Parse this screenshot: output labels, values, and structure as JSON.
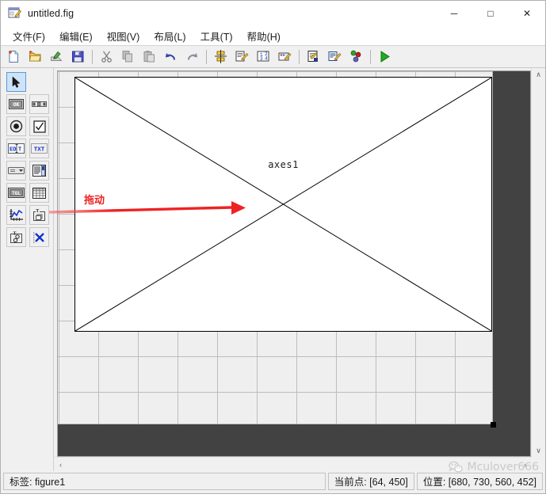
{
  "window": {
    "title": "untitled.fig",
    "icon": "guide-figure-icon",
    "minimize": "─",
    "maximize": "□",
    "close": "✕"
  },
  "menu": {
    "items": [
      {
        "label": "文件(F)",
        "name": "menu-file"
      },
      {
        "label": "编辑(E)",
        "name": "menu-edit"
      },
      {
        "label": "视图(V)",
        "name": "menu-view"
      },
      {
        "label": "布局(L)",
        "name": "menu-layout"
      },
      {
        "label": "工具(T)",
        "name": "menu-tools"
      },
      {
        "label": "帮助(H)",
        "name": "menu-help"
      }
    ]
  },
  "toolbar": {
    "buttons": [
      {
        "name": "new-figure-icon",
        "tip": "New"
      },
      {
        "name": "open-figure-icon",
        "tip": "Open"
      },
      {
        "name": "export-figure-icon",
        "tip": "Export"
      },
      {
        "name": "save-figure-icon",
        "tip": "Save"
      },
      {
        "name": "separator"
      },
      {
        "name": "cut-icon",
        "tip": "Cut"
      },
      {
        "name": "copy-icon",
        "tip": "Copy"
      },
      {
        "name": "paste-icon",
        "tip": "Paste"
      },
      {
        "name": "undo-icon",
        "tip": "Undo"
      },
      {
        "name": "redo-icon",
        "tip": "Redo"
      },
      {
        "name": "separator"
      },
      {
        "name": "align-objects-icon",
        "tip": "Align Objects"
      },
      {
        "name": "menu-editor-icon",
        "tip": "Menu Editor"
      },
      {
        "name": "tab-order-editor-icon",
        "tip": "Tab Order Editor"
      },
      {
        "name": "toolbar-editor-icon",
        "tip": "Toolbar Editor"
      },
      {
        "name": "separator"
      },
      {
        "name": "m-file-editor-icon",
        "tip": "M-file Editor"
      },
      {
        "name": "property-inspector-icon",
        "tip": "Property Inspector"
      },
      {
        "name": "object-browser-icon",
        "tip": "Object Browser"
      },
      {
        "name": "separator"
      },
      {
        "name": "run-figure-icon",
        "tip": "Run"
      }
    ]
  },
  "palette": {
    "rows": [
      [
        {
          "name": "pointer-tool",
          "glyph": "pointer",
          "selected": true
        }
      ],
      [
        {
          "name": "push-button-tool",
          "glyph": "OK"
        },
        {
          "name": "slider-tool",
          "glyph": "slider"
        }
      ],
      [
        {
          "name": "radio-button-tool",
          "glyph": "radio"
        },
        {
          "name": "check-box-tool",
          "glyph": "check"
        }
      ],
      [
        {
          "name": "edit-text-tool",
          "glyph": "EDIT"
        },
        {
          "name": "static-text-tool",
          "glyph": "TXT"
        }
      ],
      [
        {
          "name": "popup-menu-tool",
          "glyph": "popup"
        },
        {
          "name": "listbox-tool",
          "glyph": "listbox"
        }
      ],
      [
        {
          "name": "toggle-button-tool",
          "glyph": "TGL"
        },
        {
          "name": "table-tool",
          "glyph": "table"
        }
      ],
      [
        {
          "name": "axes-tool",
          "glyph": "axes"
        },
        {
          "name": "panel-tool",
          "glyph": "panel"
        }
      ],
      [
        {
          "name": "button-group-tool",
          "glyph": "buttongroup"
        },
        {
          "name": "activex-tool",
          "glyph": "activex"
        }
      ]
    ]
  },
  "canvas": {
    "axes_label": "axes1",
    "figure_position": [
      680,
      730,
      560,
      452
    ]
  },
  "annotation": {
    "label": "拖动",
    "color": "#ee2222"
  },
  "statusbar": {
    "tag": "标签: figure1",
    "current_point": "当前点:  [64, 450]",
    "position": "位置: [680, 730, 560, 452]"
  },
  "watermark": {
    "text": "Mculover666",
    "icon": "wechat-icon"
  },
  "scrollbars": {
    "up": "∧",
    "down": "∨",
    "left": "‹",
    "right": "›"
  }
}
